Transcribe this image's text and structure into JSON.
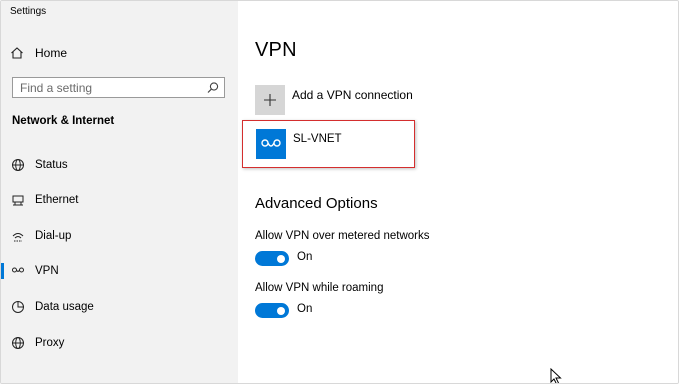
{
  "window": {
    "title": "Settings"
  },
  "sidebar": {
    "home_label": "Home",
    "search_placeholder": "Find a setting",
    "section_title": "Network & Internet",
    "items": [
      {
        "label": "Status",
        "icon": "globe-icon",
        "active": false
      },
      {
        "label": "Ethernet",
        "icon": "ethernet-icon",
        "active": false
      },
      {
        "label": "Dial-up",
        "icon": "dialup-icon",
        "active": false
      },
      {
        "label": "VPN",
        "icon": "vpn-icon",
        "active": true
      },
      {
        "label": "Data usage",
        "icon": "data-usage-icon",
        "active": false
      },
      {
        "label": "Proxy",
        "icon": "proxy-globe-icon",
        "active": false
      }
    ]
  },
  "main": {
    "title": "VPN",
    "add_connection_label": "Add a VPN connection",
    "connections": [
      {
        "name": "SL-VNET",
        "icon": "vpn-connection-icon"
      }
    ],
    "advanced": {
      "title": "Advanced Options",
      "options": [
        {
          "label": "Allow VPN over metered networks",
          "state": "On",
          "enabled": true
        },
        {
          "label": "Allow VPN while roaming",
          "state": "On",
          "enabled": true
        }
      ]
    }
  },
  "colors": {
    "accent": "#0078d7",
    "sidebar_bg": "#f2f2f2",
    "highlight_border": "#d42e2e",
    "add_tile_bg": "#d6d6d6"
  }
}
